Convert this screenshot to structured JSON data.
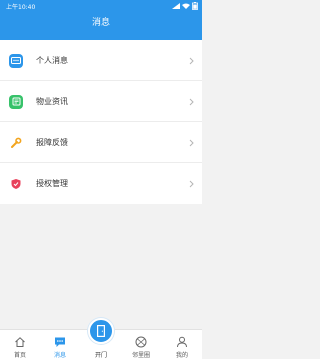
{
  "status_bar": {
    "time": "上午10:40"
  },
  "header": {
    "title": "消息"
  },
  "menu": {
    "items": [
      {
        "label": "个人消息",
        "icon": "personal-message-icon",
        "color": "#2c96ea"
      },
      {
        "label": "物业资讯",
        "icon": "property-news-icon",
        "color": "#37c26a"
      },
      {
        "label": "报障反馈",
        "icon": "repair-feedback-icon",
        "color": "#f3a51f"
      },
      {
        "label": "授权管理",
        "icon": "authorization-icon",
        "color": "#e8415b"
      }
    ]
  },
  "tabbar": {
    "items": [
      {
        "label": "首页",
        "icon": "home-icon",
        "active": false
      },
      {
        "label": "消息",
        "icon": "message-icon",
        "active": true
      },
      {
        "label": "开门",
        "icon": "door-icon",
        "active": false
      },
      {
        "label": "邻里圈",
        "icon": "neighborhood-icon",
        "active": false
      },
      {
        "label": "我的",
        "icon": "profile-icon",
        "active": false
      }
    ]
  },
  "theme": {
    "accent": "#2c96ea"
  }
}
